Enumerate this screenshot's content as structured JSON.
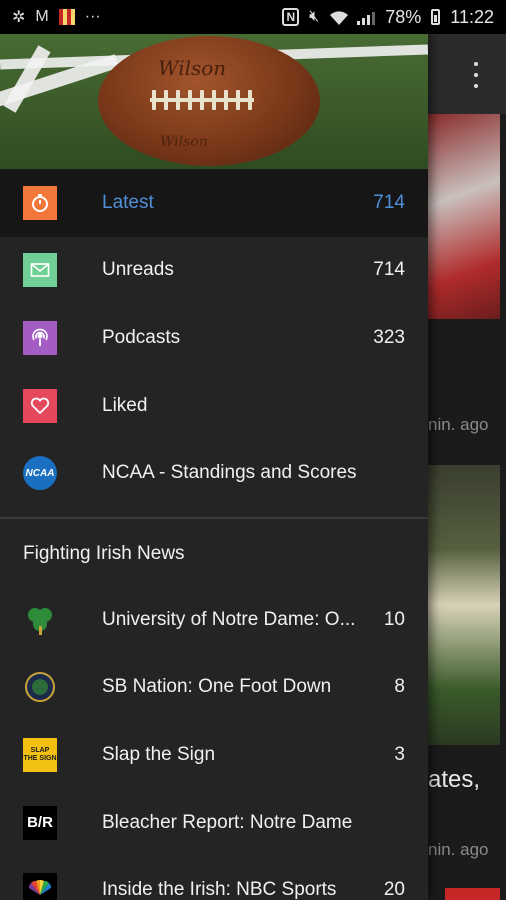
{
  "status_bar": {
    "battery": "78%",
    "time": "11:22",
    "more": "···"
  },
  "background": {
    "card1_time": "nin. ago",
    "card2_title": "ates,",
    "card2_time": "nin. ago"
  },
  "header": {
    "ball_brand": "Wilson",
    "ball_brand_small": "Wilson"
  },
  "nav": [
    {
      "label": "Latest",
      "count": "714",
      "icon": "timer-icon",
      "color": "#f2783a",
      "active": true
    },
    {
      "label": "Unreads",
      "count": "714",
      "icon": "mail-icon",
      "color": "#6fcf97",
      "active": false
    },
    {
      "label": "Podcasts",
      "count": "323",
      "icon": "podcast-icon",
      "color": "#a25cc4",
      "active": false
    },
    {
      "label": "Liked",
      "count": "",
      "icon": "heart-icon",
      "color": "#e5475b",
      "active": false
    },
    {
      "label": "NCAA - Standings and Scores",
      "count": "",
      "icon": "ncaa-icon",
      "color": "#1a6fc0",
      "active": false
    }
  ],
  "section_title": "Fighting Irish News",
  "feeds": [
    {
      "label": "University of Notre Dame: O...",
      "count": "10",
      "icon": "shamrock-icon"
    },
    {
      "label": "SB Nation: One Foot Down",
      "count": "8",
      "icon": "one-foot-down-icon"
    },
    {
      "label": "Slap the Sign",
      "count": "3",
      "icon": "slap-the-sign-icon",
      "logo_text": "SLAP THE SIGN"
    },
    {
      "label": "Bleacher Report: Notre Dame",
      "count": "",
      "icon": "bleacher-report-icon",
      "logo_text": "B/R"
    },
    {
      "label": "Inside the Irish: NBC Sports",
      "count": "20",
      "icon": "nbc-peacock-icon"
    }
  ]
}
